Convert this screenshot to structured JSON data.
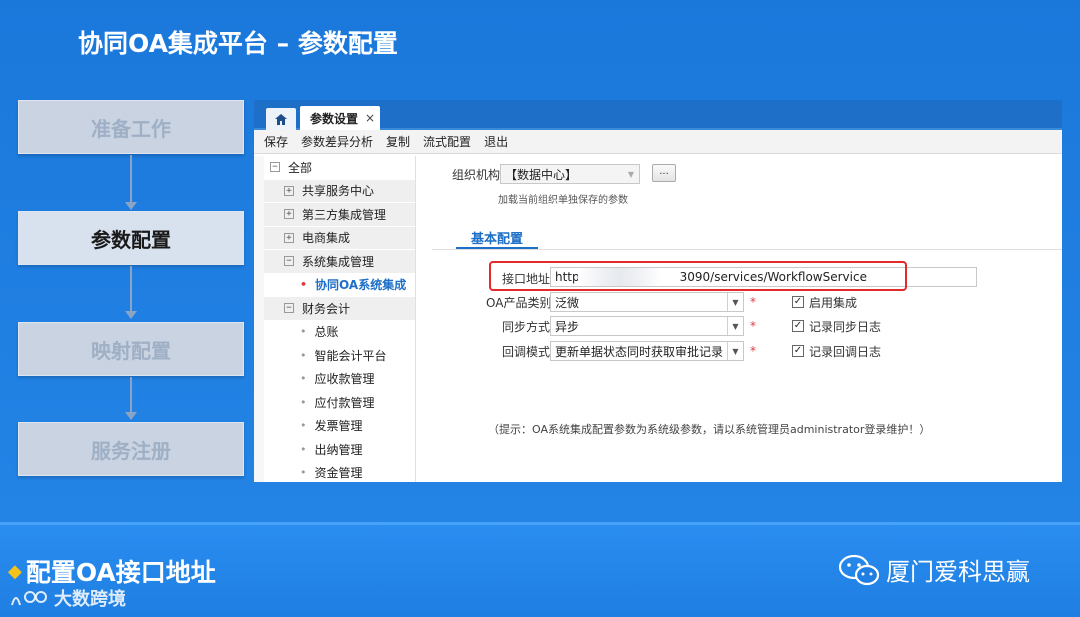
{
  "slide": {
    "title": "协同OA集成平台 – 参数配置",
    "steps": [
      {
        "label": "准备工作",
        "active": false
      },
      {
        "label": "参数配置",
        "active": true
      },
      {
        "label": "映射配置",
        "active": false
      },
      {
        "label": "服务注册",
        "active": false
      }
    ],
    "bottom_title": "配置OA接口地址",
    "watermark": "大数跨境",
    "brand": "厦门爱科思赢"
  },
  "app": {
    "tab_label": "参数设置",
    "tab_close": "×",
    "toolbar": [
      "保存",
      "参数差异分析",
      "复制",
      "流式配置",
      "退出"
    ],
    "tree": [
      {
        "label": "全部",
        "expander": "⊟",
        "level": 0
      },
      {
        "label": "共享服务中心",
        "expander": "⊞",
        "level": 1
      },
      {
        "label": "第三方集成管理",
        "expander": "⊞",
        "level": 1
      },
      {
        "label": "电商集成",
        "expander": "⊞",
        "level": 1
      },
      {
        "label": "系统集成管理",
        "expander": "⊟",
        "level": 1
      },
      {
        "label": "协同OA系统集成",
        "expander": "•",
        "level": 2,
        "selected": true
      },
      {
        "label": "财务会计",
        "expander": "⊟",
        "level": 1
      },
      {
        "label": "总账",
        "expander": "•",
        "level": 2
      },
      {
        "label": "智能会计平台",
        "expander": "•",
        "level": 2
      },
      {
        "label": "应收款管理",
        "expander": "•",
        "level": 2
      },
      {
        "label": "应付款管理",
        "expander": "•",
        "level": 2
      },
      {
        "label": "发票管理",
        "expander": "•",
        "level": 2
      },
      {
        "label": "出纳管理",
        "expander": "•",
        "level": 2
      },
      {
        "label": "资金管理",
        "expander": "•",
        "level": 2
      }
    ],
    "org": {
      "label": "组织机构",
      "value": "【数据中心】",
      "hint": "加载当前组织单独保存的参数",
      "browse": "..."
    },
    "section_tab": "基本配置",
    "form": {
      "url_label": "接口地址",
      "url_prefix": "http",
      "url_suffix": "3090/services/WorkflowService",
      "oa_type_label": "OA产品类别",
      "oa_type_value": "泛微",
      "sync_label": "同步方式",
      "sync_value": "异步",
      "callback_label": "回调模式",
      "callback_value": "更新单据状态同时获取审批记录",
      "required_mark": "*",
      "check_enable": "启用集成",
      "check_sync_log": "记录同步日志",
      "check_callback_log": "记录回调日志",
      "check_mark": "✓"
    },
    "tip": "（提示：OA系统集成配置参数为系统级参数，请以系统管理员administrator登录维护！）"
  },
  "colors": {
    "slide_bg": "#1b78db",
    "tab_blue": "#1e6fc7",
    "highlight_red": "#e32b2b",
    "diamond_gold": "#f5c21b"
  }
}
